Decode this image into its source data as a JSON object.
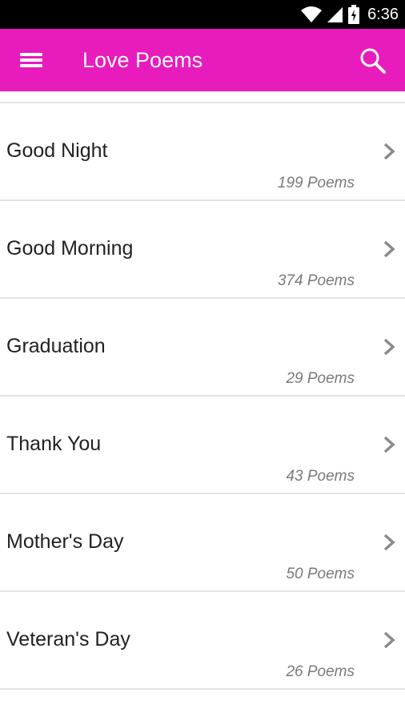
{
  "status_bar": {
    "time": "6:36",
    "icons": [
      "wifi-icon",
      "cell-signal-icon",
      "battery-charging-icon"
    ]
  },
  "app_bar": {
    "title": "Love Poems",
    "menu_icon": "hamburger-menu-icon",
    "search_icon": "search-icon",
    "background_color": "#e81bbd"
  },
  "categories": [
    {
      "title": "Good Night",
      "count": "199 Poems"
    },
    {
      "title": "Good Morning",
      "count": "374 Poems"
    },
    {
      "title": "Graduation",
      "count": "29 Poems"
    },
    {
      "title": "Thank You",
      "count": "43 Poems"
    },
    {
      "title": "Mother's Day",
      "count": "50 Poems"
    },
    {
      "title": "Veteran's Day",
      "count": "26 Poems"
    }
  ]
}
